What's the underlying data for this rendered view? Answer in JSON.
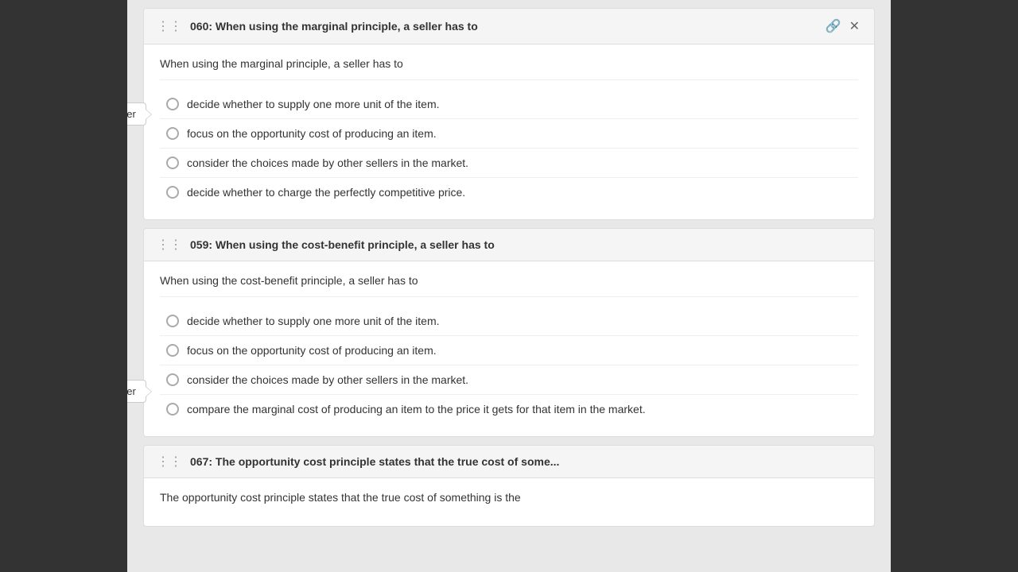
{
  "questions": [
    {
      "id": "q060",
      "number": "060",
      "title": "060: When using the marginal principle, a seller has to",
      "body_text": "When using the marginal principle, a seller has to",
      "has_icons": true,
      "correct_answer_badge": "Correct Answer",
      "correct_answer_badge_position": "top",
      "options": [
        {
          "text": "decide whether to supply one more unit of the item."
        },
        {
          "text": "focus on the opportunity cost of producing an item."
        },
        {
          "text": "consider the choices made by other sellers in the market."
        },
        {
          "text": "decide whether to charge the perfectly competitive price."
        }
      ]
    },
    {
      "id": "q059",
      "number": "059",
      "title": "059: When using the cost-benefit principle, a seller has to",
      "body_text": "When using the cost-benefit principle, a seller has to",
      "has_icons": false,
      "correct_answer_badge": "Correct Answer",
      "correct_answer_badge_position": "bottom",
      "options": [
        {
          "text": "decide whether to supply one more unit of the item."
        },
        {
          "text": "focus on the opportunity cost of producing an item."
        },
        {
          "text": "consider the choices made by other sellers in the market."
        },
        {
          "text": "compare the marginal cost of producing an item to the price it gets for that item in the market."
        }
      ]
    },
    {
      "id": "q067",
      "number": "067",
      "title": "067: The opportunity cost principle states that the true cost of some...",
      "body_text": "The opportunity cost principle states that the true cost of something is the",
      "has_icons": false,
      "options": []
    }
  ],
  "icons": {
    "drag": "⋮⋮",
    "paperclip": "📎",
    "close": "✕"
  }
}
